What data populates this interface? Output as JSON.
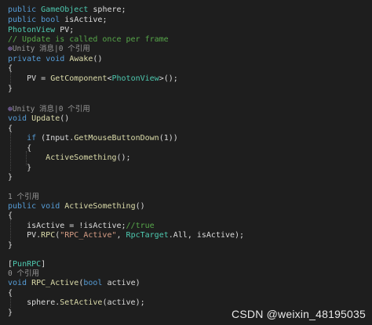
{
  "code": {
    "l1": {
      "kw": "public",
      "ty": "GameObject",
      "rest": "sphere;"
    },
    "l2": {
      "kw1": "public",
      "kw2": "bool",
      "rest": "isActive;"
    },
    "l3": {
      "ty": "PhotonView",
      "rest": "PV;"
    },
    "l4": {
      "comment": "// Update is called once per frame"
    },
    "lens1": {
      "icon": "⊕",
      "text": "Unity 消息|0 个引用"
    },
    "l5": {
      "kw1": "private",
      "kw2": "void",
      "fn": "Awake",
      "rest": "()"
    },
    "l6": {
      "text": "{"
    },
    "l7": {
      "pre": "PV = ",
      "fn": "GetComponent",
      "lt": "<",
      "ty": "PhotonView",
      "post": ">();"
    },
    "l8": {
      "text": "}"
    },
    "lens2": {
      "icon": "⊕",
      "text": "Unity 消息|0 个引用"
    },
    "l9": {
      "kw": "void",
      "fn": "Update",
      "rest": "()"
    },
    "l10": {
      "text": "{"
    },
    "l11": {
      "kw": "if",
      "pre": " (Input.",
      "fn": "GetMouseButtonDown",
      "post": "(1))"
    },
    "l12": {
      "text": "{"
    },
    "l13": {
      "fn": "ActiveSomething",
      "post": "();"
    },
    "l14": {
      "text": "}"
    },
    "l15": {
      "text": "}"
    },
    "lens3": {
      "text": "1 个引用"
    },
    "l16": {
      "kw1": "public",
      "kw2": "void",
      "fn": "ActiveSomething",
      "rest": "()"
    },
    "l17": {
      "text": "{"
    },
    "l18": {
      "pre": "isActive = !isActive;",
      "comment": "//true"
    },
    "l19": {
      "pre": "PV.",
      "fn": "RPC",
      "open": "(",
      "str": "\"RPC_Active\"",
      "mid": ", ",
      "ty": "RpcTarget",
      "post": ".All, isActive);"
    },
    "l20": {
      "text": "}"
    },
    "l21": {
      "open": "[",
      "ty": "PunRPC",
      "close": "]"
    },
    "lens4": {
      "text": "0 个引用"
    },
    "l22": {
      "kw1": "void",
      "fn": "RPC_Active",
      "open": "(",
      "kw2": "bool",
      "post": " active)"
    },
    "l23": {
      "text": "{"
    },
    "l24": {
      "pre": "sphere.",
      "fn": "SetActive",
      "post": "(active);"
    },
    "l25": {
      "text": "}"
    }
  },
  "watermark": "CSDN @weixin_48195035",
  "colors": {
    "background": "#1e1e1e",
    "keyword": "#569cd6",
    "type": "#4ec9b0",
    "comment": "#57a64a",
    "string": "#d69d85",
    "method": "#dcdcaa",
    "plain": "#dcdcdc"
  }
}
